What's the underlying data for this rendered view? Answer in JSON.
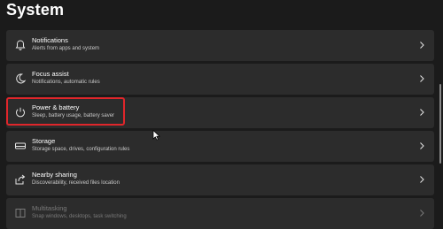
{
  "header": {
    "title": "System"
  },
  "items": [
    {
      "title": "Notifications",
      "subtitle": "Alerts from apps and system",
      "icon": "bell-icon"
    },
    {
      "title": "Focus assist",
      "subtitle": "Notifications, automatic rules",
      "icon": "moon-icon"
    },
    {
      "title": "Power & battery",
      "subtitle": "Sleep, battery usage, battery saver",
      "icon": "power-icon"
    },
    {
      "title": "Storage",
      "subtitle": "Storage space, drives, configuration rules",
      "icon": "storage-icon"
    },
    {
      "title": "Nearby sharing",
      "subtitle": "Discoverability, received files location",
      "icon": "share-icon"
    },
    {
      "title": "Multitasking",
      "subtitle": "Snap windows, desktops, task switching",
      "icon": "multitasking-icon"
    }
  ],
  "highlight_color": "#e0262b"
}
